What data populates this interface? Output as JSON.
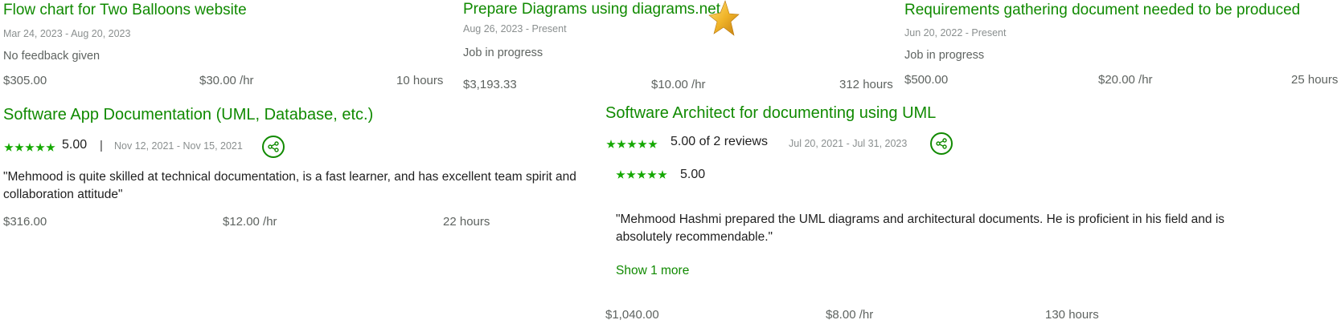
{
  "jobs": [
    {
      "title": "Flow chart for Two Balloons website",
      "dates": "Mar 24, 2023 - Aug 20, 2023",
      "status": "No feedback given",
      "earned": "$305.00",
      "rate": "$30.00 /hr",
      "hours": "10 hours"
    },
    {
      "title": "Prepare Diagrams using diagrams.net",
      "dates": "Aug 26, 2023 - Present",
      "status": "Job in progress",
      "earned": "$3,193.33",
      "rate": "$10.00 /hr",
      "hours": "312 hours",
      "badge_icon": "gold-star-icon"
    },
    {
      "title": "Requirements gathering document needed to be produced",
      "dates": "Jun 20, 2022 - Present",
      "status": "Job in progress",
      "earned": "$500.00",
      "rate": "$20.00 /hr",
      "hours": "25 hours"
    },
    {
      "title": "Software App Documentation (UML, Database, etc.)",
      "rating": {
        "score": "5.00",
        "stars": 5
      },
      "separator": "|",
      "dates": "Nov 12, 2021 - Nov 15, 2021",
      "quote": "\"Mehmood is quite skilled at technical documentation, is a fast learner, and has excellent team spirit and collaboration attitude\"",
      "earned": "$316.00",
      "rate": "$12.00 /hr",
      "hours": "22 hours"
    },
    {
      "title": "Software Architect for documenting using UML",
      "rating": {
        "score": "5.00 of 2 reviews",
        "stars": 5
      },
      "dates": "Jul 20, 2021 - Jul 31, 2023",
      "sub_rating": {
        "score": "5.00",
        "stars": 5
      },
      "quote": "\"Mehmood Hashmi prepared the UML diagrams and architectural documents. He is proficient in his field and is absolutely recommendable.\"",
      "show_more": "Show 1 more",
      "earned": "$1,040.00",
      "rate": "$8.00 /hr",
      "hours": "130 hours"
    }
  ],
  "colors": {
    "accent": "#108a00",
    "star": "#14a800",
    "muted": "#5e6360",
    "date": "#8a8f8f",
    "badge_star": "#e3a51b"
  }
}
